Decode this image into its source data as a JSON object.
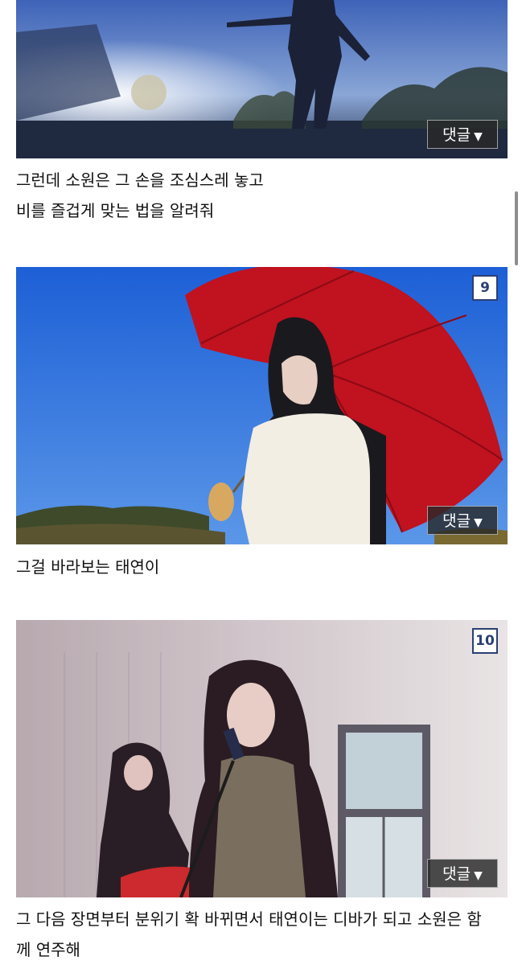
{
  "posts": [
    {
      "caption_lines": [
        "그런데 소원은 그 손을 조심스레 놓고",
        "비를 즐겁게 맞는 법을 알려줘"
      ],
      "comment_label": "댓글",
      "comment_arrow": "▼"
    },
    {
      "number": "9",
      "caption_lines": [
        "그걸 바라보는 태연이"
      ],
      "comment_label": "댓글",
      "comment_arrow": "▼"
    },
    {
      "number": "10",
      "caption_lines": [
        "그 다음 장면부터 분위기 확 바뀌면서 태연이는 디바가 되고 소원은 함",
        "께 연주해"
      ],
      "comment_label": "댓글",
      "comment_arrow": "▼"
    }
  ],
  "colors": {
    "badge_border": "#2b3f73",
    "comment_bg": "#282828"
  }
}
